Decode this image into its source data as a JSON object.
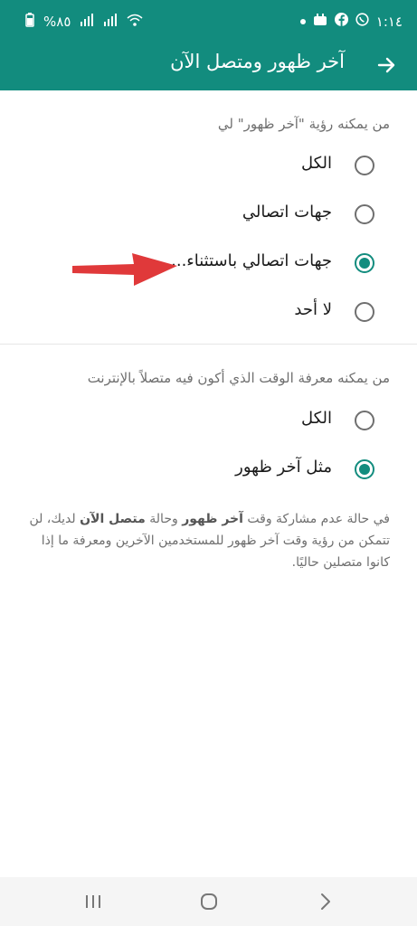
{
  "status_bar": {
    "battery": "%٨٥",
    "time": "١:١٤"
  },
  "header": {
    "title": "آخر ظهور ومتصل الآن"
  },
  "last_seen": {
    "label": "من يمكنه رؤية \"آخر ظهور\" لي",
    "options": [
      {
        "label": "الكل",
        "selected": false
      },
      {
        "label": "جهات اتصالي",
        "selected": false
      },
      {
        "label": "جهات اتصالي باستثناء...",
        "selected": true
      },
      {
        "label": "لا أحد",
        "selected": false
      }
    ]
  },
  "online": {
    "label": "من يمكنه معرفة الوقت الذي أكون فيه متصلاً بالإنترنت",
    "options": [
      {
        "label": "الكل",
        "selected": false
      },
      {
        "label": "مثل آخر ظهور",
        "selected": true
      }
    ]
  },
  "note": {
    "part1": "في حالة عدم مشاركة وقت ",
    "bold1": "آخر ظهور",
    "part2": " وحالة ",
    "bold2": "متصل الآن",
    "part3": " لديك، لن تتمكن من رؤية وقت آخر ظهور للمستخدمين الآخرين ومعرفة ما إذا كانوا متصلين حاليًا."
  },
  "colors": {
    "brand": "#128c7e",
    "annotation_arrow": "#e0393a"
  },
  "icons": [
    "back-arrow-icon",
    "wifi-icon",
    "signal-icon",
    "facebook-icon",
    "whatsapp-icon",
    "recents-icon",
    "home-icon",
    "back-nav-icon"
  ]
}
